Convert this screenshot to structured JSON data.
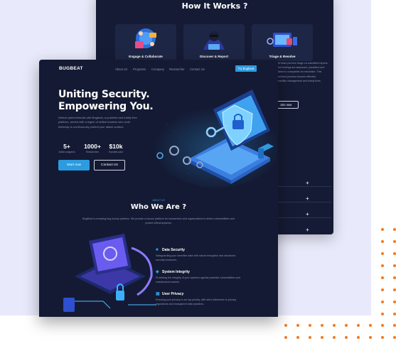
{
  "back": {
    "title": "How It Works ?",
    "cards": [
      {
        "label": "Engage & Collaborate"
      },
      {
        "label": "Discover & Report"
      },
      {
        "label": "Triage & Resolve"
      }
    ],
    "description": "Expert team perform triage on submitted reports. Verified findings are assessed, prioritized and escalated to companies for resolution. This streamlined process ensures effective vulnerability management and timely fixes.",
    "button": "Join now",
    "faq_plus": [
      "+",
      "+",
      "+",
      "+"
    ]
  },
  "front": {
    "logo": "BUGBEAT",
    "nav": [
      "About Us",
      "Programs",
      "Company",
      "Researcher",
      "Contact Us"
    ],
    "try_button": "Try Bugbeat",
    "hero": {
      "title_line1": "Uniting Security.",
      "title_line2": "Empowering You.",
      "subtitle": "Defeat cybercriminals with Bugbeat, a powerful and totally free platform, armed with a legion of skilled hackers who work tirelessly to continuously protect your attack surface.",
      "stats": [
        {
          "num": "5+",
          "label": "Active programs"
        },
        {
          "num": "1000+",
          "label": "Researchers"
        },
        {
          "num": "$10k",
          "label": "Bounties paid"
        }
      ],
      "start_button": "Start now",
      "contact_button": "Contact Us"
    },
    "who": {
      "kicker": "ABOUT US",
      "title": "Who We Are ?",
      "subtitle": "BugBeat is a leading bug bounty platform. We provide a secure platform for researchers and organizations to detect vulnerabilities and protect critical systems."
    },
    "features": [
      {
        "title": "Data Security",
        "desc": "Safeguarding your sensitive data with robust encryption and advanced security measures."
      },
      {
        "title": "System Integrity",
        "desc": "Protecting the integrity of your systems against potential vulnerabilities and unauthorized access."
      },
      {
        "title": "User Privacy",
        "desc": "Ensuring your privacy is our top priority, with strict adherence to privacy regulations and transparent data practices."
      }
    ]
  },
  "colors": {
    "accent": "#2d9be0",
    "dots": "#f07a23",
    "panel": "#141a33",
    "background": "#e8eafb"
  }
}
